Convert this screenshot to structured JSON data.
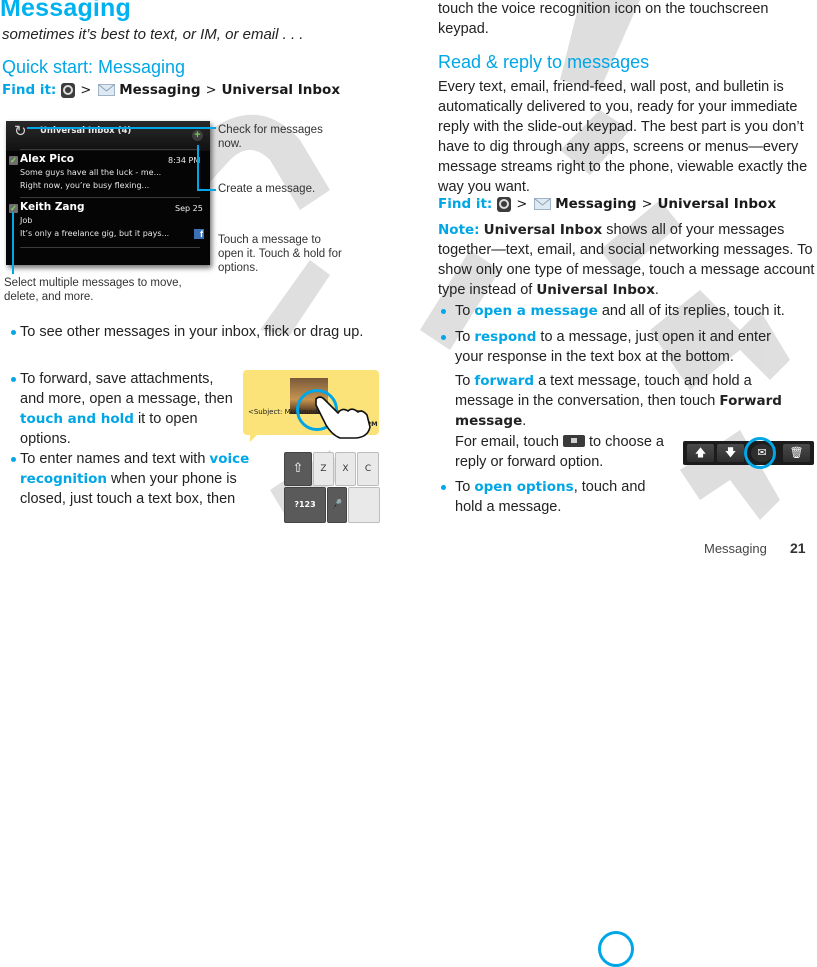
{
  "page": {
    "title": "Messaging",
    "subtitle": "sometimes it’s best to text, or IM, or email . . .",
    "footer_section": "Messaging",
    "page_number": "21"
  },
  "quick_start": {
    "heading": "Quick start: Messaging",
    "find_it": {
      "label": "Find it:",
      "sep": ">",
      "step1": "Messaging",
      "step2": "Universal Inbox"
    }
  },
  "phone_screen": {
    "title": "Universal Inbox (4)",
    "messages": [
      {
        "sender": "Alex Pico",
        "time": "8:34 PM",
        "line1": "Some guys have all the luck - me...",
        "line2": "Right now, you’re busy flexing..."
      },
      {
        "sender": "Keith Zang",
        "time": "Sep 25",
        "line1": "Job",
        "line2": "It’s only a freelance gig, but it pays..."
      }
    ],
    "icons": [
      "refresh-icon",
      "add-message-icon",
      "checkbox-icon",
      "facebook-icon"
    ]
  },
  "callouts": {
    "refresh": "Check for messages now.",
    "create": "Create a message.",
    "touch": "Touch a message to open it. Touch & hold for options.",
    "select": "Select multiple messages to move, delete, and more."
  },
  "bullets_left": [
    {
      "text": "To see other messages in your inbox, flick or drag up."
    },
    {
      "pre": "To forward, save attachments, and more, open a message, then ",
      "kw": "touch and hold",
      "post": " it to open options."
    },
    {
      "pre": "To enter names and text with ",
      "kw": "voice recognition",
      "post": " when your phone is closed, just touch a text box, then touch the voice recognition icon on the touchscreen keypad."
    }
  ],
  "bubble": {
    "subject": "<Subject: Multimedia Message>",
    "time": "30 PM"
  },
  "keypad": {
    "keys": [
      "shift",
      "Z",
      "X",
      "C",
      "?123",
      "mic",
      ""
    ]
  },
  "read_reply": {
    "heading": "Read & reply to messages",
    "body": "Every text, email, friend-feed, wall post, and bulletin is automatically delivered to you, ready for your immediate reply with the slide-out keypad. The best part is you don’t have to dig through any apps, screens or menus—every message streams right to the phone, viewable exactly the way you want.",
    "find_it": {
      "label": "Find it:",
      "sep": ">",
      "step1": "Messaging",
      "step2": "Universal Inbox"
    },
    "note": {
      "label": "Note:",
      "b1": "Universal Inbox",
      "t1": " shows all of your messages together—text, email, and social networking messages. To show only one type of message, touch a message account type instead of ",
      "b2": "Universal Inbox",
      "t2": "."
    },
    "bullets": [
      {
        "pre": "To ",
        "kw": "open a message",
        "post": " and all of its replies, touch it."
      },
      {
        "pre": "To ",
        "kw": "respond",
        "post": " to a message, just open it and enter your response in the text box at the bottom."
      }
    ],
    "forward": {
      "pre": "To ",
      "kw": "forward",
      "mid": " a text message, touch and hold a message in the conversation, then touch ",
      "b": "Forward message",
      "post": "."
    },
    "email": {
      "pre": "For email, touch",
      "post": " to choose a reply or forward option."
    },
    "options": {
      "pre": "To ",
      "kw": "open options",
      "post": ", touch and hold a message."
    }
  },
  "toolbar": {
    "buttons": [
      "up-arrow",
      "down-arrow",
      "reply-forward",
      "delete"
    ]
  },
  "colors": {
    "accent": "#00a6e6",
    "title": "#00b2f0",
    "bubble": "#fbe37a"
  }
}
